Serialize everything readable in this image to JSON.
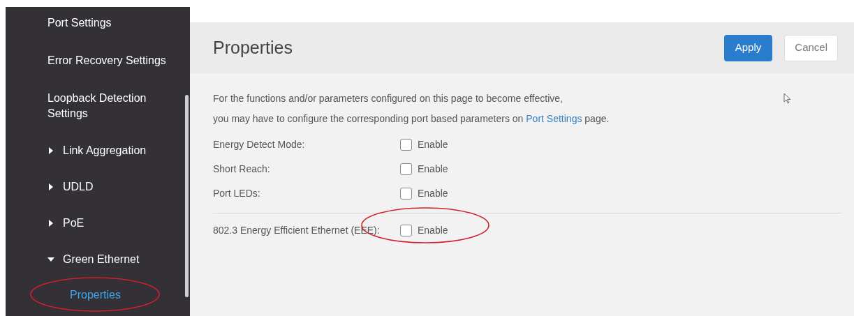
{
  "sidebar": {
    "items": [
      {
        "label": "Port Settings",
        "kind": "link",
        "selected": false
      },
      {
        "label": "Error Recovery Settings",
        "kind": "link",
        "selected": false
      },
      {
        "label": "Loopback Detection Settings",
        "kind": "link",
        "selected": false
      },
      {
        "label": "Link Aggregation",
        "kind": "group",
        "expanded": false,
        "selected": false
      },
      {
        "label": "UDLD",
        "kind": "group",
        "expanded": false,
        "selected": false
      },
      {
        "label": "PoE",
        "kind": "group",
        "expanded": false,
        "selected": false
      },
      {
        "label": "Green Ethernet",
        "kind": "group",
        "expanded": true,
        "selected": false,
        "children": [
          {
            "label": "Properties",
            "kind": "link",
            "selected": true
          }
        ]
      }
    ]
  },
  "page": {
    "title": "Properties",
    "buttons": [
      {
        "label": "Apply",
        "kind": "primary"
      },
      {
        "label": "Cancel",
        "kind": "secondary"
      }
    ],
    "note": [
      "For the functions and/or parameters configured on this page to become effective,",
      "you may have to configure the corresponding port based parameters on"
    ],
    "note_link": "Port Settings",
    "note_end": "page.",
    "settings": [
      {
        "label": "Energy Detect Mode:",
        "option": "Enable",
        "checked": false
      },
      {
        "label": "Short Reach:",
        "option": "Enable",
        "checked": false
      },
      {
        "label": "Port LEDs:",
        "option": "Enable",
        "checked": false
      }
    ],
    "eee_settings": [
      {
        "label": "802.3 Energy Efficient Ethernet (EEE):",
        "option": "Enable",
        "checked": false
      }
    ]
  }
}
